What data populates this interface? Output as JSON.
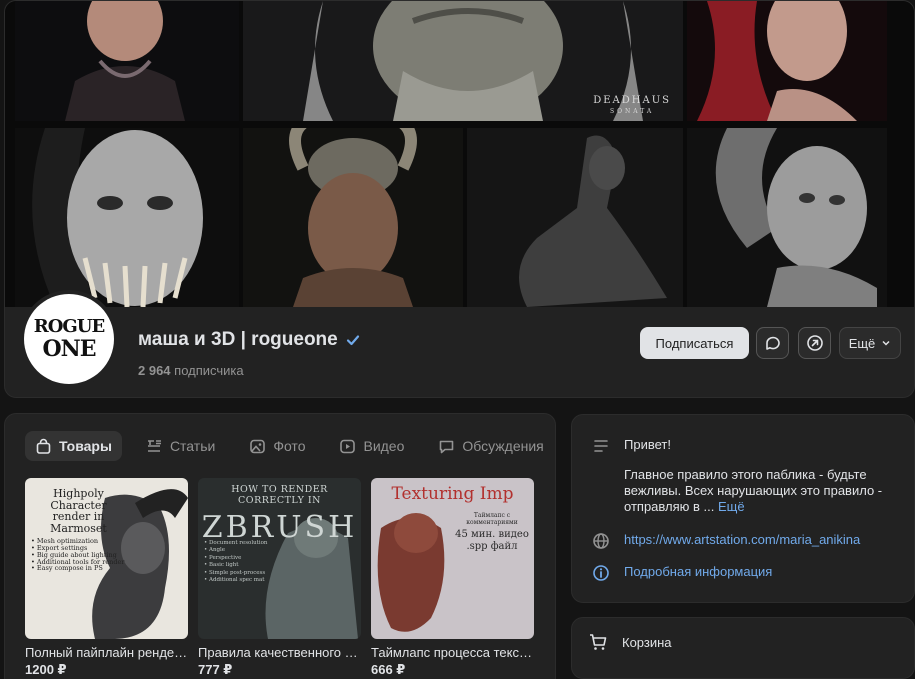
{
  "cover": {
    "watermark_line1": "DEADHAUS",
    "watermark_line2": "SONATA"
  },
  "profile": {
    "avatar_text_line1": "ROGUE",
    "avatar_text_line2": "ONE",
    "title": "маша и 3D | rogueone",
    "subscribers_count": "2 964",
    "subscribers_label": "подписчика",
    "subscribe_label": "Подписаться",
    "more_label": "Ещё"
  },
  "tabs": [
    {
      "label": "Товары",
      "icon": "bag-icon",
      "active": true
    },
    {
      "label": "Статьи",
      "icon": "article-icon",
      "active": false
    },
    {
      "label": "Фото",
      "icon": "photo-icon",
      "active": false
    },
    {
      "label": "Видео",
      "icon": "video-icon",
      "active": false
    },
    {
      "label": "Обсуждения",
      "icon": "discussion-icon",
      "active": false
    }
  ],
  "products": [
    {
      "name": "Полный пайплайн рендера",
      "price": "1200 ₽",
      "cover_title": "Highpoly Character render in Marmoset",
      "cover_lines": [
        "• Mesh optimization",
        "• Export settings",
        "• Big guide about lighting",
        "• Additional tools for render",
        "• Easy compose in PS"
      ]
    },
    {
      "name": "Правила качественного рендера",
      "price": "777 ₽",
      "cover_title": "HOW TO RENDER CORRECTLY IN",
      "cover_brand": "ZBRUSH",
      "cover_lines": [
        "• Document resolution",
        "• Angle",
        "• Perspective",
        "• Basic light",
        "• Simple post-process",
        "• Additional spec mat"
      ]
    },
    {
      "name": "Таймлапс процесса текстуринга",
      "price": "666 ₽",
      "cover_title": "Texturing Imp",
      "cover_lines": [
        "Таймлапс с комментариями",
        "45 мин. видео",
        ".spp файл"
      ]
    }
  ],
  "info": {
    "greeting": "Привет!",
    "rule_text": "Главное правило этого паблика - будьте вежливы. Всех нарушающих это правило - отправляю в ...",
    "more_link": "Ещё",
    "website": "https://www.artstation.com/maria_anikina",
    "details_link": "Подробная информация"
  },
  "cart": {
    "label": "Корзина"
  },
  "colors": {
    "accent_link": "#71aaeb",
    "panel_bg": "#222222",
    "page_bg": "#141414"
  }
}
